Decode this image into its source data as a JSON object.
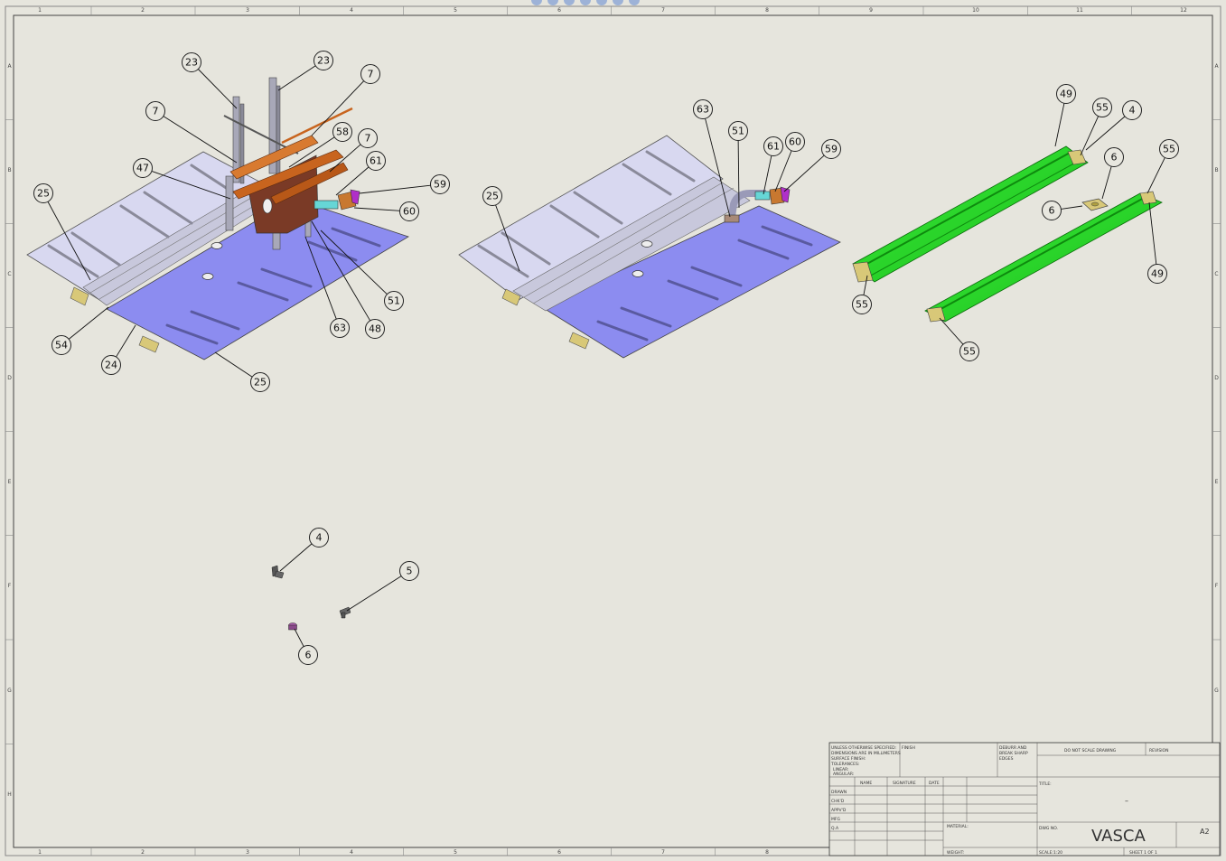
{
  "sheet": {
    "background": "#e6e5dd",
    "zones_top": [
      "1",
      "2",
      "3",
      "4",
      "5",
      "6",
      "7",
      "8",
      "9",
      "10",
      "11",
      "12"
    ],
    "zones_bottom": [
      "1",
      "2",
      "3",
      "4",
      "5",
      "6",
      "7",
      "8"
    ],
    "zones_left": [
      "A",
      "B",
      "C",
      "D",
      "E",
      "F",
      "G",
      "H"
    ],
    "zones_right": [
      "A",
      "B",
      "C",
      "D",
      "E",
      "F",
      "G",
      "H"
    ]
  },
  "toolbar": {
    "icons": [
      "zoom-fit-icon",
      "zoom-area-icon",
      "previous-view-icon",
      "rotate-view-icon",
      "section-view-icon",
      "display-style-icon",
      "hide-show-icon"
    ]
  },
  "views": {
    "view_left": {
      "balloons": [
        "23",
        "23",
        "7",
        "7",
        "58",
        "7",
        "47",
        "61",
        "59",
        "25",
        "60",
        "51",
        "63",
        "48",
        "54",
        "24",
        "25"
      ]
    },
    "view_middle": {
      "balloons": [
        "63",
        "51",
        "61",
        "60",
        "59",
        "25"
      ]
    },
    "view_right": {
      "balloons": [
        "49",
        "55",
        "4",
        "6",
        "55",
        "6",
        "49",
        "55",
        "55"
      ]
    },
    "view_parts": {
      "balloons": [
        "4",
        "5",
        "6"
      ]
    }
  },
  "colors": {
    "plate_light": "#d8d8f0",
    "plate_blue": "#8c8cf0",
    "rail": "#a8a8b8",
    "copper": "#c8641e",
    "brown": "#7a3a26",
    "green": "#28e028",
    "green_dark": "#1aa01a",
    "cyan": "#66d6d6",
    "magenta": "#b030c8",
    "tan": "#d8c878"
  },
  "title_block": {
    "general_notes": [
      "UNLESS OTHERWISE SPECIFIED:",
      "DIMENSIONS ARE IN MILLIMETERS",
      "SURFACE FINISH:",
      "TOLERANCES:",
      "LINEAR:",
      "ANGULAR:"
    ],
    "finish_label": "FINISH",
    "deburr_notes": [
      "DEBURR AND",
      "BREAK SHARP",
      "EDGES"
    ],
    "do_not_scale": "DO NOT SCALE DRAWING",
    "revision_label": "REVISION",
    "col_name": "NAME",
    "col_signature": "SIGNATURE",
    "col_date": "DATE",
    "rows": [
      "DRAWN",
      "CHK'D",
      "APPV'D",
      "MFG",
      "Q.A"
    ],
    "material_label": "MATERIAL:",
    "weight_label": "WEIGHT:",
    "title_label": "TITLE:",
    "title_dash": "–",
    "dwg_no_label": "DWG NO.",
    "drawing_title": "VASCA",
    "sheet_size": "A2",
    "scale_label": "SCALE:1:20",
    "sheet_label": "SHEET 1 OF 1"
  }
}
